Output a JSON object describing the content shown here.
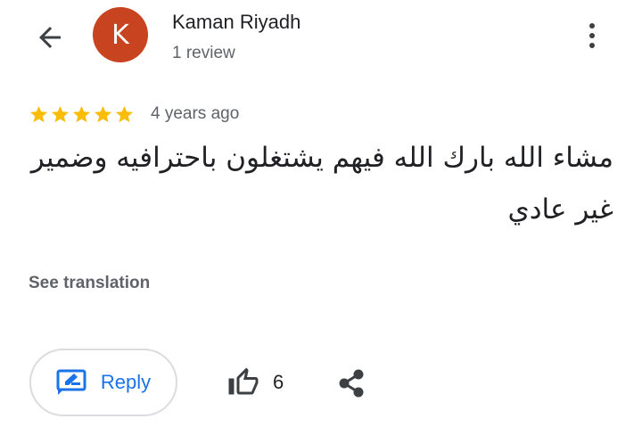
{
  "header": {
    "avatar_letter": "K",
    "avatar_color": "#c8431f",
    "reviewer_name": "Kaman Riyadh",
    "review_count": "1 review",
    "back_icon": "arrow-back-icon",
    "more_icon": "more-vert-icon"
  },
  "review": {
    "rating": 5,
    "max_rating": 5,
    "star_color": "#fbbc04",
    "date": "4 years ago",
    "text": "مشاء الله بارك الله فيهم يشتغلون باحترافيه وضمير غير عادي",
    "see_translation": "See translation"
  },
  "actions": {
    "reply_label": "Reply",
    "reply_icon": "rate-review-icon",
    "like_icon": "thumb-up-icon",
    "like_count": "6",
    "share_icon": "share-icon",
    "accent_color": "#1a73e8"
  }
}
